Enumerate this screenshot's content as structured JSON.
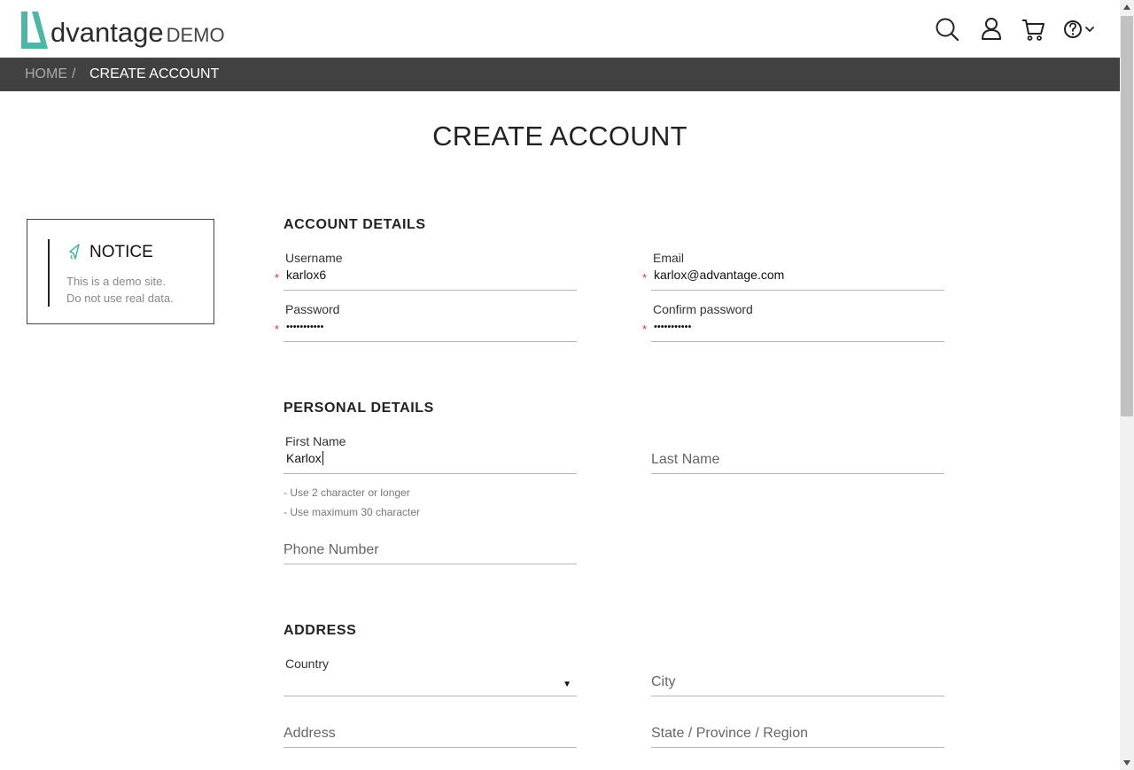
{
  "brand": {
    "name": "dvantage",
    "suffix": "DEMO",
    "accent": "#4eb6a7"
  },
  "header": {
    "icons": [
      "search-icon",
      "user-icon",
      "cart-icon",
      "help-icon",
      "chevron-down-icon"
    ]
  },
  "breadcrumb": {
    "home": "HOME",
    "separator": "/",
    "current": "CREATE ACCOUNT"
  },
  "page_title": "CREATE ACCOUNT",
  "notice": {
    "title": "NOTICE",
    "line1": "This is a demo site.",
    "line2": "Do not use real data."
  },
  "sections": {
    "account": "ACCOUNT DETAILS",
    "personal": "PERSONAL DETAILS",
    "address": "ADDRESS"
  },
  "fields": {
    "username": {
      "label": "Username",
      "value": "karlox6",
      "required": true
    },
    "email": {
      "label": "Email",
      "value": "karlox@advantage.com",
      "required": true
    },
    "password": {
      "label": "Password",
      "value": "•••••••••••",
      "required": true
    },
    "confirm_password": {
      "label": "Confirm password",
      "value": "•••••••••••",
      "required": true
    },
    "first_name": {
      "label": "First Name",
      "value": "Karlox"
    },
    "last_name": {
      "placeholder": "Last Name"
    },
    "phone": {
      "placeholder": "Phone Number"
    },
    "country": {
      "label": "Country",
      "value": ""
    },
    "city": {
      "placeholder": "City"
    },
    "address": {
      "placeholder": "Address"
    },
    "state": {
      "placeholder": "State / Province / Region"
    }
  },
  "hints": [
    "- Use 2 character or longer",
    "- Use maximum 30 character"
  ],
  "required_marker": "*",
  "colors": {
    "breadcrumb_bg": "#414141",
    "required": "#dd3333"
  }
}
